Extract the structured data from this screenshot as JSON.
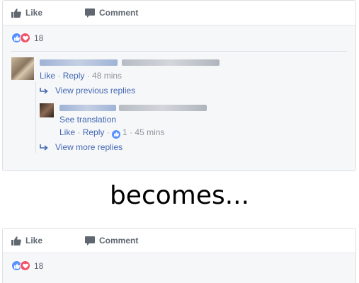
{
  "top_card": {
    "actions": {
      "like": "Like",
      "comment": "Comment"
    },
    "reaction_count": "18",
    "comment": {
      "like": "Like",
      "sep1": " · ",
      "reply": "Reply",
      "time": " · 48 mins"
    },
    "view_previous": "View previous replies",
    "reply": {
      "see_translation": "See translation",
      "like": "Like",
      "sep1": " · ",
      "reply": "Reply",
      "sep2": " · ",
      "like_count": "1",
      "time": " · 45 mins"
    },
    "view_more": "View more replies"
  },
  "middle_text": "becomes...",
  "bottom_card": {
    "actions": {
      "like": "Like",
      "comment": "Comment"
    },
    "reaction_count": "18"
  },
  "colors": {
    "link": "#4267b2",
    "like_reaction": "#5890ff",
    "love_reaction": "#f25268",
    "muted": "#90949c"
  },
  "icons": [
    "thumbs-up-icon",
    "comment-bubble-icon",
    "like-reaction-icon",
    "love-reaction-icon",
    "reply-arrow-icon"
  ]
}
